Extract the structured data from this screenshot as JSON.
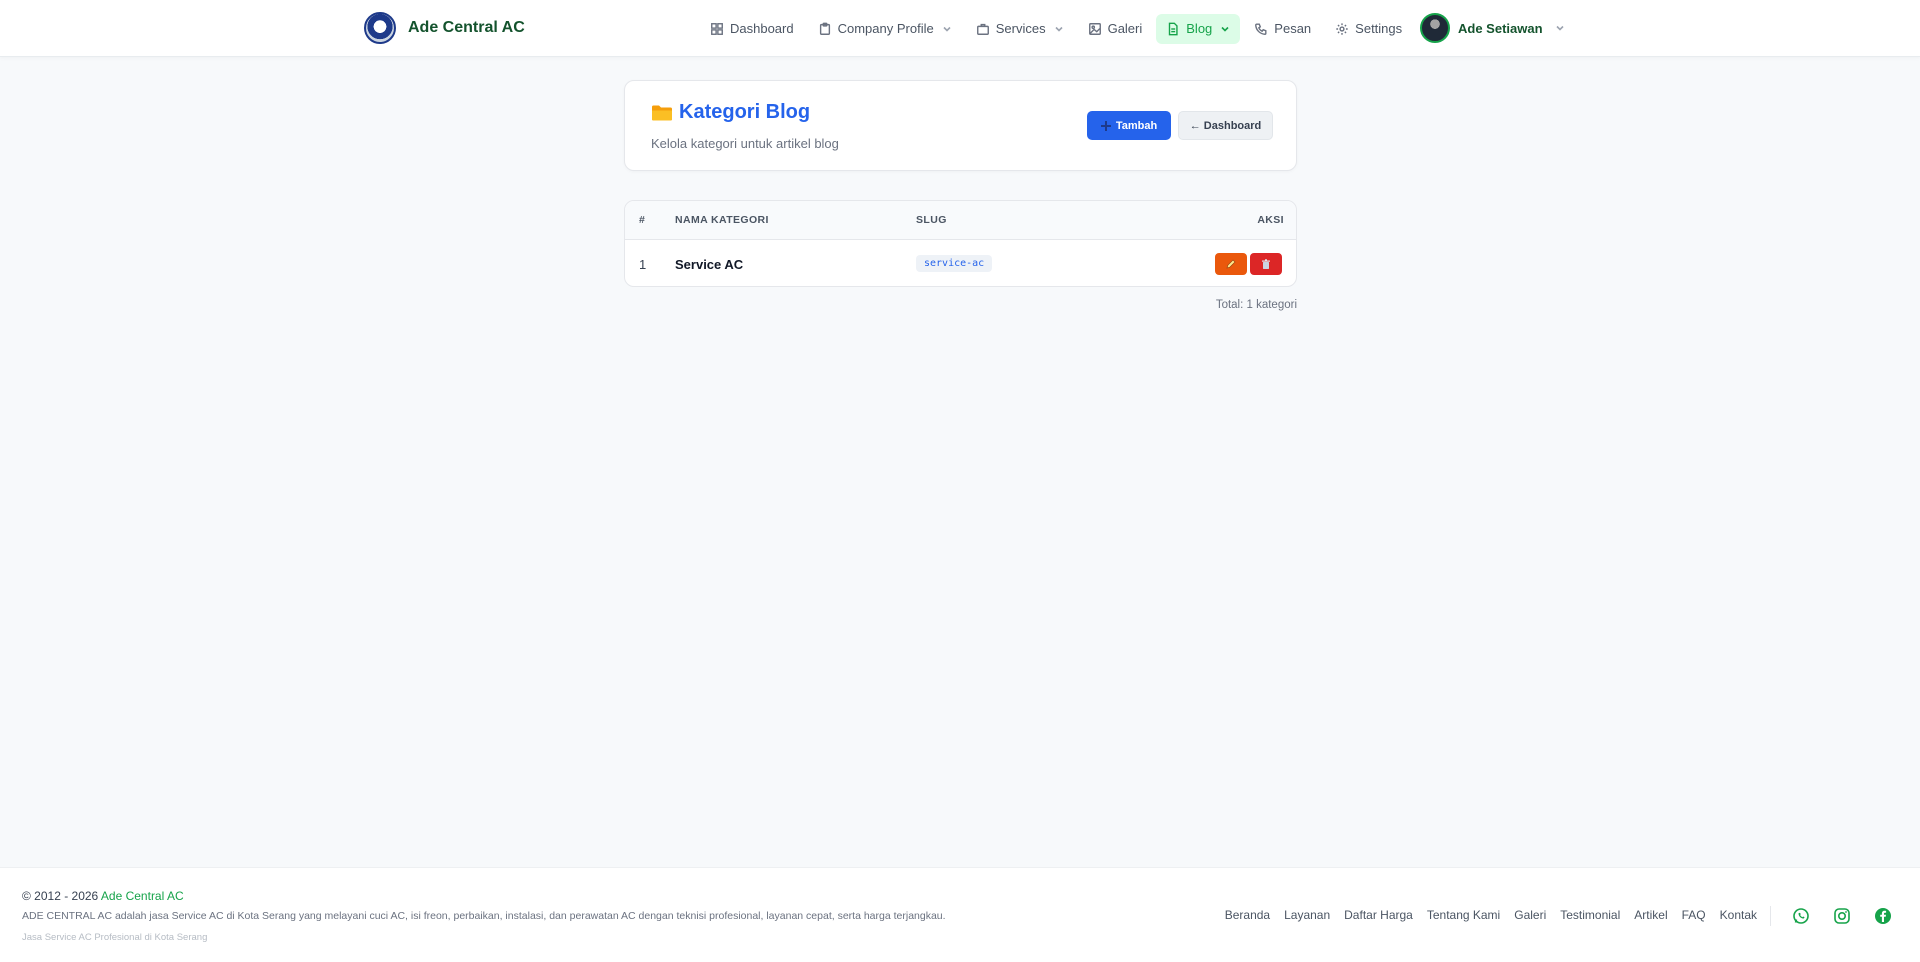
{
  "navbar": {
    "brand_name": "Ade Central AC",
    "items": [
      {
        "label": "Dashboard",
        "icon": "grid-icon"
      },
      {
        "label": "Company Profile",
        "icon": "clipboard-icon",
        "dropdown": true
      },
      {
        "label": "Services",
        "icon": "briefcase-icon",
        "dropdown": true
      },
      {
        "label": "Galeri",
        "icon": "image-icon"
      },
      {
        "label": "Blog",
        "icon": "document-icon",
        "dropdown": true,
        "active": true
      },
      {
        "label": "Pesan",
        "icon": "phone-icon"
      },
      {
        "label": "Settings",
        "icon": "gear-icon"
      }
    ],
    "user_name": "Ade Setiawan"
  },
  "header": {
    "title": "Kategori Blog",
    "title_icon": "folder-icon",
    "subtitle": "Kelola kategori untuk artikel blog",
    "add_label": "Tambah",
    "back_label": "← Dashboard"
  },
  "table": {
    "columns": [
      "#",
      "NAMA KATEGORI",
      "SLUG",
      "AKSI"
    ],
    "rows": [
      {
        "num": "1",
        "name": "Service AC",
        "slug": "service-ac"
      }
    ],
    "total": "Total: 1 kategori"
  },
  "footer": {
    "copyright": "© 2012 - 2026 ",
    "brand": "Ade Central AC",
    "description": "ADE CENTRAL AC adalah jasa Service AC di Kota Serang yang melayani cuci AC, isi freon, perbaikan, instalasi, dan perawatan AC dengan teknisi profesional, layanan cepat, serta harga terjangkau.",
    "tagline": "Jasa Service AC Profesional di Kota Serang",
    "links": [
      "Beranda",
      "Layanan",
      "Daftar Harga",
      "Tentang Kami",
      "Galeri",
      "Testimonial",
      "Artikel",
      "FAQ",
      "Kontak"
    ],
    "social": [
      "whatsapp-icon",
      "instagram-icon",
      "facebook-icon"
    ]
  },
  "colors": {
    "brand_green": "#16a34a",
    "primary_blue": "#2563eb",
    "edit_orange": "#ea580c",
    "delete_red": "#dc2626"
  }
}
